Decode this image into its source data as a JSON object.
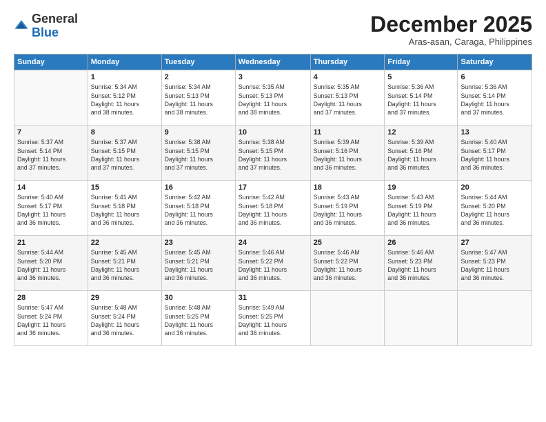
{
  "logo": {
    "general": "General",
    "blue": "Blue"
  },
  "title": "December 2025",
  "subtitle": "Aras-asan, Caraga, Philippines",
  "days_header": [
    "Sunday",
    "Monday",
    "Tuesday",
    "Wednesday",
    "Thursday",
    "Friday",
    "Saturday"
  ],
  "weeks": [
    [
      {
        "day": "",
        "sunrise": "",
        "sunset": "",
        "daylight": ""
      },
      {
        "day": "1",
        "sunrise": "Sunrise: 5:34 AM",
        "sunset": "Sunset: 5:12 PM",
        "daylight": "Daylight: 11 hours and 38 minutes."
      },
      {
        "day": "2",
        "sunrise": "Sunrise: 5:34 AM",
        "sunset": "Sunset: 5:13 PM",
        "daylight": "Daylight: 11 hours and 38 minutes."
      },
      {
        "day": "3",
        "sunrise": "Sunrise: 5:35 AM",
        "sunset": "Sunset: 5:13 PM",
        "daylight": "Daylight: 11 hours and 38 minutes."
      },
      {
        "day": "4",
        "sunrise": "Sunrise: 5:35 AM",
        "sunset": "Sunset: 5:13 PM",
        "daylight": "Daylight: 11 hours and 37 minutes."
      },
      {
        "day": "5",
        "sunrise": "Sunrise: 5:36 AM",
        "sunset": "Sunset: 5:14 PM",
        "daylight": "Daylight: 11 hours and 37 minutes."
      },
      {
        "day": "6",
        "sunrise": "Sunrise: 5:36 AM",
        "sunset": "Sunset: 5:14 PM",
        "daylight": "Daylight: 11 hours and 37 minutes."
      }
    ],
    [
      {
        "day": "7",
        "sunrise": "Sunrise: 5:37 AM",
        "sunset": "Sunset: 5:14 PM",
        "daylight": "Daylight: 11 hours and 37 minutes."
      },
      {
        "day": "8",
        "sunrise": "Sunrise: 5:37 AM",
        "sunset": "Sunset: 5:15 PM",
        "daylight": "Daylight: 11 hours and 37 minutes."
      },
      {
        "day": "9",
        "sunrise": "Sunrise: 5:38 AM",
        "sunset": "Sunset: 5:15 PM",
        "daylight": "Daylight: 11 hours and 37 minutes."
      },
      {
        "day": "10",
        "sunrise": "Sunrise: 5:38 AM",
        "sunset": "Sunset: 5:15 PM",
        "daylight": "Daylight: 11 hours and 37 minutes."
      },
      {
        "day": "11",
        "sunrise": "Sunrise: 5:39 AM",
        "sunset": "Sunset: 5:16 PM",
        "daylight": "Daylight: 11 hours and 36 minutes."
      },
      {
        "day": "12",
        "sunrise": "Sunrise: 5:39 AM",
        "sunset": "Sunset: 5:16 PM",
        "daylight": "Daylight: 11 hours and 36 minutes."
      },
      {
        "day": "13",
        "sunrise": "Sunrise: 5:40 AM",
        "sunset": "Sunset: 5:17 PM",
        "daylight": "Daylight: 11 hours and 36 minutes."
      }
    ],
    [
      {
        "day": "14",
        "sunrise": "Sunrise: 5:40 AM",
        "sunset": "Sunset: 5:17 PM",
        "daylight": "Daylight: 11 hours and 36 minutes."
      },
      {
        "day": "15",
        "sunrise": "Sunrise: 5:41 AM",
        "sunset": "Sunset: 5:18 PM",
        "daylight": "Daylight: 11 hours and 36 minutes."
      },
      {
        "day": "16",
        "sunrise": "Sunrise: 5:42 AM",
        "sunset": "Sunset: 5:18 PM",
        "daylight": "Daylight: 11 hours and 36 minutes."
      },
      {
        "day": "17",
        "sunrise": "Sunrise: 5:42 AM",
        "sunset": "Sunset: 5:18 PM",
        "daylight": "Daylight: 11 hours and 36 minutes."
      },
      {
        "day": "18",
        "sunrise": "Sunrise: 5:43 AM",
        "sunset": "Sunset: 5:19 PM",
        "daylight": "Daylight: 11 hours and 36 minutes."
      },
      {
        "day": "19",
        "sunrise": "Sunrise: 5:43 AM",
        "sunset": "Sunset: 5:19 PM",
        "daylight": "Daylight: 11 hours and 36 minutes."
      },
      {
        "day": "20",
        "sunrise": "Sunrise: 5:44 AM",
        "sunset": "Sunset: 5:20 PM",
        "daylight": "Daylight: 11 hours and 36 minutes."
      }
    ],
    [
      {
        "day": "21",
        "sunrise": "Sunrise: 5:44 AM",
        "sunset": "Sunset: 5:20 PM",
        "daylight": "Daylight: 11 hours and 36 minutes."
      },
      {
        "day": "22",
        "sunrise": "Sunrise: 5:45 AM",
        "sunset": "Sunset: 5:21 PM",
        "daylight": "Daylight: 11 hours and 36 minutes."
      },
      {
        "day": "23",
        "sunrise": "Sunrise: 5:45 AM",
        "sunset": "Sunset: 5:21 PM",
        "daylight": "Daylight: 11 hours and 36 minutes."
      },
      {
        "day": "24",
        "sunrise": "Sunrise: 5:46 AM",
        "sunset": "Sunset: 5:22 PM",
        "daylight": "Daylight: 11 hours and 36 minutes."
      },
      {
        "day": "25",
        "sunrise": "Sunrise: 5:46 AM",
        "sunset": "Sunset: 5:22 PM",
        "daylight": "Daylight: 11 hours and 36 minutes."
      },
      {
        "day": "26",
        "sunrise": "Sunrise: 5:46 AM",
        "sunset": "Sunset: 5:23 PM",
        "daylight": "Daylight: 11 hours and 36 minutes."
      },
      {
        "day": "27",
        "sunrise": "Sunrise: 5:47 AM",
        "sunset": "Sunset: 5:23 PM",
        "daylight": "Daylight: 11 hours and 36 minutes."
      }
    ],
    [
      {
        "day": "28",
        "sunrise": "Sunrise: 5:47 AM",
        "sunset": "Sunset: 5:24 PM",
        "daylight": "Daylight: 11 hours and 36 minutes."
      },
      {
        "day": "29",
        "sunrise": "Sunrise: 5:48 AM",
        "sunset": "Sunset: 5:24 PM",
        "daylight": "Daylight: 11 hours and 36 minutes."
      },
      {
        "day": "30",
        "sunrise": "Sunrise: 5:48 AM",
        "sunset": "Sunset: 5:25 PM",
        "daylight": "Daylight: 11 hours and 36 minutes."
      },
      {
        "day": "31",
        "sunrise": "Sunrise: 5:49 AM",
        "sunset": "Sunset: 5:25 PM",
        "daylight": "Daylight: 11 hours and 36 minutes."
      },
      {
        "day": "",
        "sunrise": "",
        "sunset": "",
        "daylight": ""
      },
      {
        "day": "",
        "sunrise": "",
        "sunset": "",
        "daylight": ""
      },
      {
        "day": "",
        "sunrise": "",
        "sunset": "",
        "daylight": ""
      }
    ]
  ]
}
